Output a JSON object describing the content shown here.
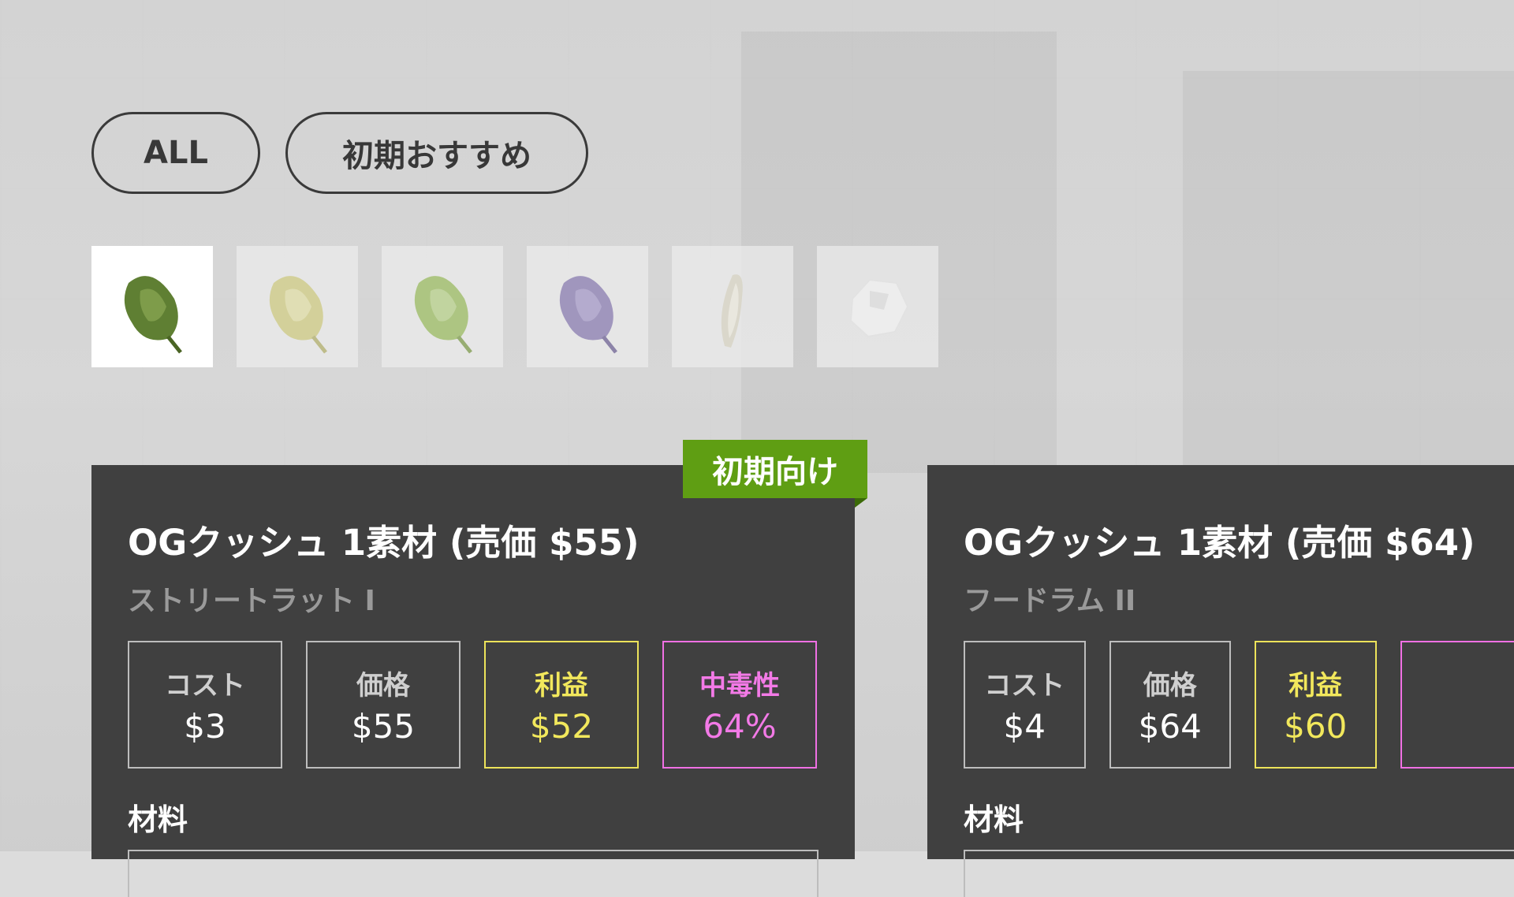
{
  "filters": {
    "all_label": "ALL",
    "recommended_label": "初期おすすめ"
  },
  "strains": [
    {
      "name": "green-strain",
      "color": "#6e8f3a",
      "selected": true
    },
    {
      "name": "yellow-strain",
      "color": "#d4d07a",
      "selected": false
    },
    {
      "name": "lime-strain",
      "color": "#9cbf59",
      "selected": false
    },
    {
      "name": "purple-strain",
      "color": "#8a7bb5",
      "selected": false
    },
    {
      "name": "white-strain",
      "color": "#d8d4c4",
      "selected": false
    },
    {
      "name": "crystal-strain",
      "color": "#f2f2f2",
      "selected": false
    }
  ],
  "cards": [
    {
      "badge": "初期向け",
      "title": "OGクッシュ 1素材 (売価 $55)",
      "subtitle": "ストリートラット I",
      "stats": {
        "cost_label": "コスト",
        "cost": "$3",
        "price_label": "価格",
        "price": "$55",
        "profit_label": "利益",
        "profit": "$52",
        "addict_label": "中毒性",
        "addict": "64%"
      },
      "materials_label": "材料"
    },
    {
      "title": "OGクッシュ 1素材 (売価 $64)",
      "subtitle": "フードラム II",
      "stats": {
        "cost_label": "コスト",
        "cost": "$4",
        "price_label": "価格",
        "price": "$64",
        "profit_label": "利益",
        "profit": "$60"
      },
      "materials_label": "材料"
    }
  ],
  "colors": {
    "badge": "#5f9e13",
    "profit": "#f2e85c",
    "addiction": "#f37ae7",
    "card": "#404040"
  }
}
